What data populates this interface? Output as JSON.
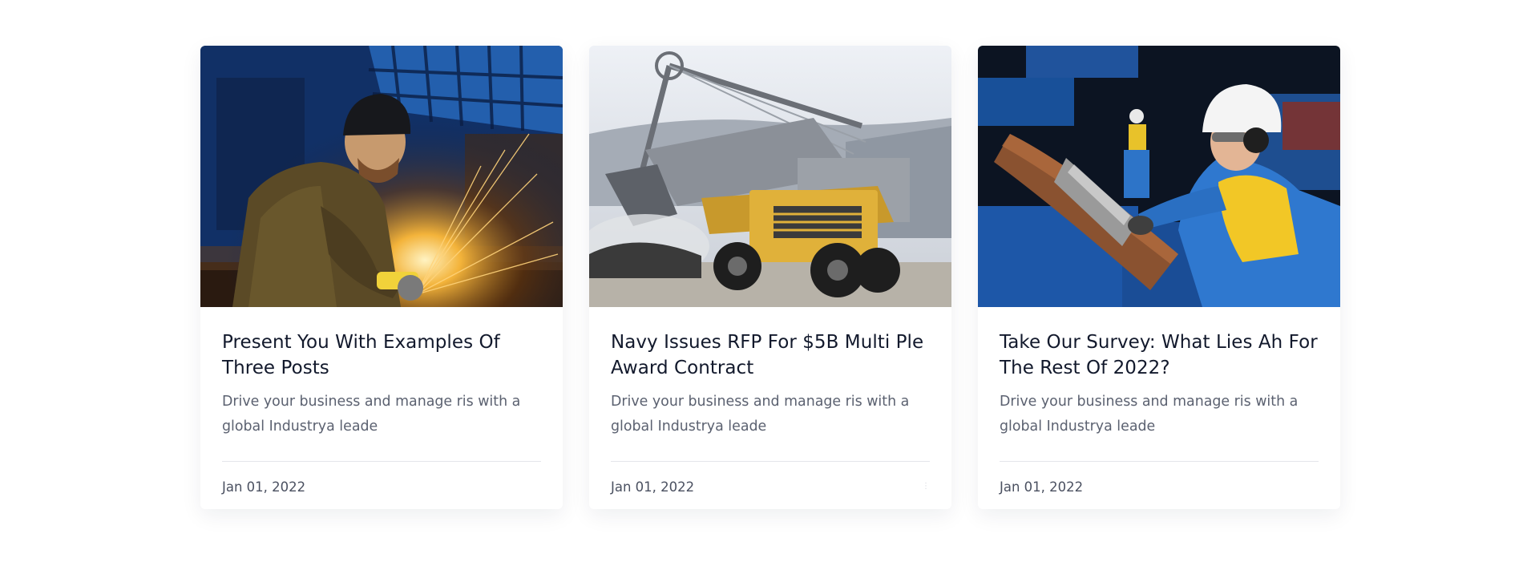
{
  "cards": [
    {
      "image": "welder-grinding-sparks-photo",
      "title": "Present You With Examples Of Three Posts",
      "excerpt": "Drive your business and manage ris with a global Industrya leade",
      "date": "Jan 01, 2022"
    },
    {
      "image": "mining-excavator-dump-truck-photo",
      "title": "Navy Issues RFP For $5B Multi Ple Award Contract",
      "excerpt": "Drive your business and manage ris with a global Industrya leade",
      "date": "Jan 01, 2022"
    },
    {
      "image": "engineer-hardhat-pipe-inspection-photo",
      "title": "Take Our Survey: What Lies Ah For The Rest Of 2022?",
      "excerpt": "Drive your business and manage ris with a global Industrya leade",
      "date": "Jan 01, 2022"
    }
  ],
  "colors": {
    "title": "#12192c",
    "excerpt": "#5b6170",
    "divider": "#e4e6ea"
  }
}
